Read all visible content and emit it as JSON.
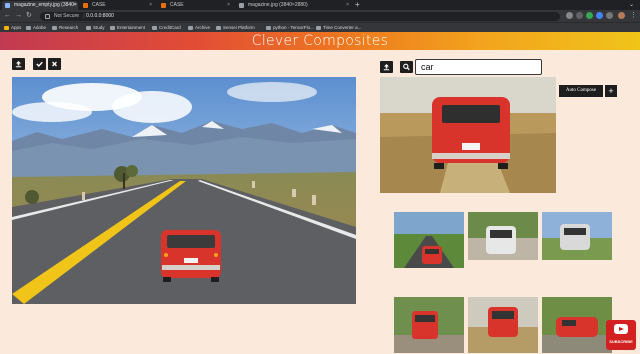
{
  "browser": {
    "tabs": [
      {
        "title": "magazine_empty.jpg (3840×"
      },
      {
        "title": "CASE"
      },
      {
        "title": "CASE"
      },
      {
        "title": "magazine.jpg (3840×2880)"
      }
    ],
    "url": "0.0.0.0:8000",
    "security_label": "Not Secure",
    "bookmarks": [
      "Apps",
      "Adobe",
      "Research",
      "Study",
      "Entertainment",
      "CreditCard",
      "Archive",
      "Sensei Platform",
      "python - TensorFlo...",
      "Time Converter a..."
    ]
  },
  "app": {
    "title": "Clever Composites",
    "search_value": "car",
    "auto_compose_label": "Auto Compose",
    "add_label": "+",
    "youtube_label": "SUBSCRIBE"
  },
  "colors": {
    "page_bg": "#fbe9dc",
    "banner_start": "#c23a52",
    "banner_end": "#f0c419",
    "van_red": "#d8342b",
    "button_dark": "#1e1e1e"
  },
  "icons": {
    "upload": "upload-icon",
    "check": "check-icon",
    "close": "close-icon",
    "search": "search-icon",
    "plus": "plus-icon"
  }
}
